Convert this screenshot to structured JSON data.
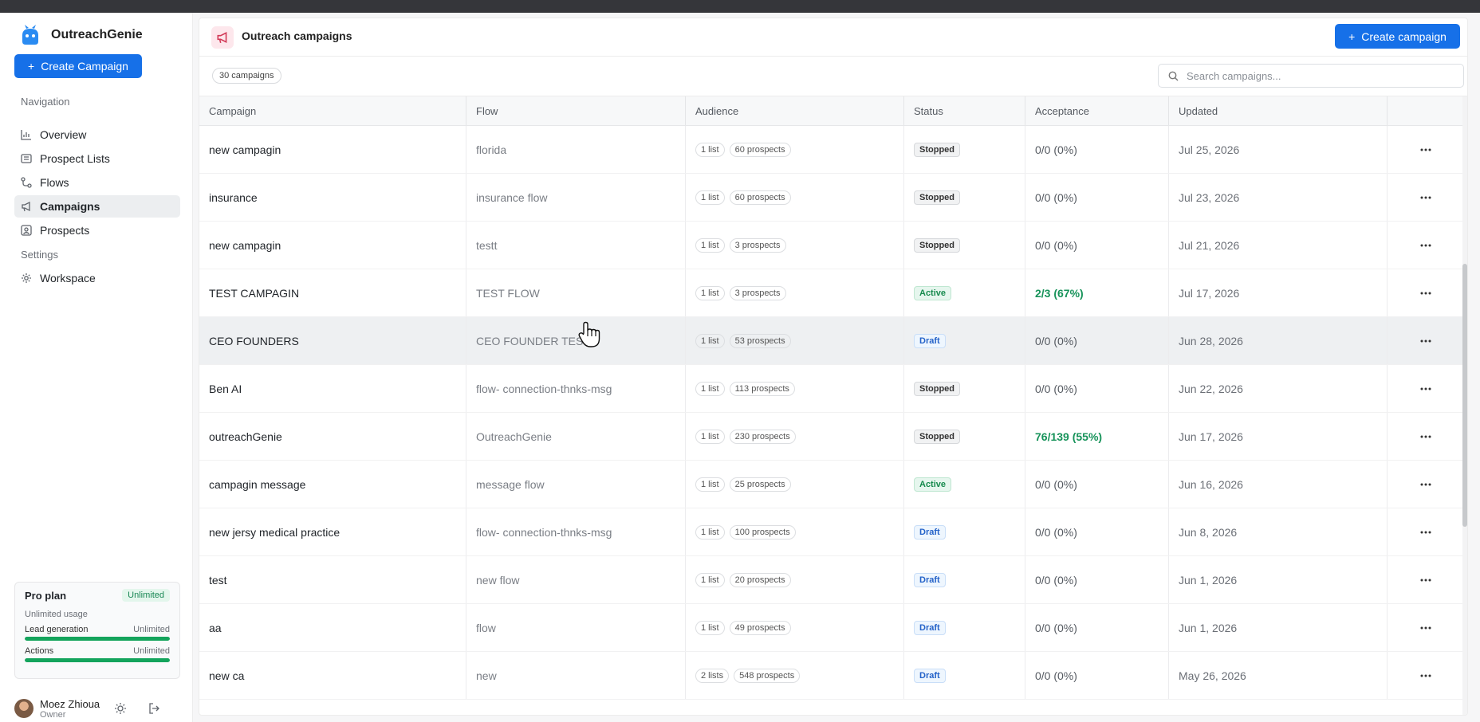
{
  "app": {
    "name": "OutreachGenie",
    "create_campaign_label": "Create Campaign"
  },
  "nav": {
    "section_title": "Navigation",
    "items": [
      {
        "label": "Overview",
        "icon": "chart-icon"
      },
      {
        "label": "Prospect Lists",
        "icon": "list-icon"
      },
      {
        "label": "Flows",
        "icon": "flow-icon"
      },
      {
        "label": "Campaigns",
        "icon": "megaphone-icon",
        "active": true
      },
      {
        "label": "Prospects",
        "icon": "contact-icon"
      }
    ],
    "settings_title": "Settings",
    "settings_items": [
      {
        "label": "Workspace",
        "icon": "gear-icon"
      }
    ]
  },
  "plan": {
    "name": "Pro plan",
    "badge": "Unlimited",
    "usage": "Unlimited usage",
    "lead_label": "Lead generation",
    "lead_value": "Unlimited",
    "actions_label": "Actions",
    "actions_value": "Unlimited",
    "lead_fill": 1,
    "actions_fill": 1
  },
  "user": {
    "name": "Moez Zhioua",
    "role": "Owner"
  },
  "header": {
    "title": "Outreach campaigns",
    "create_label": "Create campaign"
  },
  "toolbar": {
    "count": "30 campaigns",
    "search_placeholder": "Search campaigns..."
  },
  "columns": [
    "Campaign",
    "Flow",
    "Audience",
    "Status",
    "Acceptance",
    "Updated"
  ],
  "rows": [
    {
      "campaign": "new campagin",
      "flow": "florida",
      "lists": "1 list",
      "prospects": "60 prospects",
      "status": "Stopped",
      "acceptance": "0/0 (0%)",
      "updated": "Jul 25, 2026"
    },
    {
      "campaign": "insurance",
      "flow": "insurance flow",
      "lists": "1 list",
      "prospects": "60 prospects",
      "status": "Stopped",
      "acceptance": "0/0 (0%)",
      "updated": "Jul 23, 2026"
    },
    {
      "campaign": "new campagin",
      "flow": "testt",
      "lists": "1 list",
      "prospects": "3 prospects",
      "status": "Stopped",
      "acceptance": "0/0 (0%)",
      "updated": "Jul 21, 2026"
    },
    {
      "campaign": "TEST CAMPAGIN",
      "flow": "TEST FLOW",
      "lists": "1 list",
      "prospects": "3 prospects",
      "status": "Active",
      "acceptance": "2/3 (67%)",
      "updated": "Jul 17, 2026"
    },
    {
      "campaign": "CEO FOUNDERS",
      "flow": "CEO FOUNDER TEST",
      "lists": "1 list",
      "prospects": "53 prospects",
      "status": "Draft",
      "acceptance": "0/0 (0%)",
      "updated": "Jun 28, 2026"
    },
    {
      "campaign": "Ben AI",
      "flow": "flow- connection-thnks-msg",
      "lists": "1 list",
      "prospects": "113 prospects",
      "status": "Stopped",
      "acceptance": "0/0 (0%)",
      "updated": "Jun 22, 2026"
    },
    {
      "campaign": "outreachGenie",
      "flow": "OutreachGenie",
      "lists": "1 list",
      "prospects": "230 prospects",
      "status": "Stopped",
      "acceptance": "76/139 (55%)",
      "updated": "Jun 17, 2026"
    },
    {
      "campaign": "campagin message",
      "flow": "message flow",
      "lists": "1 list",
      "prospects": "25 prospects",
      "status": "Active",
      "acceptance": "0/0 (0%)",
      "updated": "Jun 16, 2026"
    },
    {
      "campaign": "new jersy medical practice",
      "flow": "flow- connection-thnks-msg",
      "lists": "1 list",
      "prospects": "100 prospects",
      "status": "Draft",
      "acceptance": "0/0 (0%)",
      "updated": "Jun 8, 2026"
    },
    {
      "campaign": "test",
      "flow": "new flow",
      "lists": "1 list",
      "prospects": "20 prospects",
      "status": "Draft",
      "acceptance": "0/0 (0%)",
      "updated": "Jun 1, 2026"
    },
    {
      "campaign": "aa",
      "flow": "flow",
      "lists": "1 list",
      "prospects": "49 prospects",
      "status": "Draft",
      "acceptance": "0/0 (0%)",
      "updated": "Jun 1, 2026"
    },
    {
      "campaign": "new ca",
      "flow": "new",
      "lists": "2 lists",
      "prospects": "548 prospects",
      "status": "Draft",
      "acceptance": "0/0 (0%)",
      "updated": "May 26, 2026"
    }
  ],
  "colors": {
    "accent": "#1670e8",
    "active": "#178a4e",
    "draft": "#2563c9",
    "progress": "#14a45c"
  }
}
